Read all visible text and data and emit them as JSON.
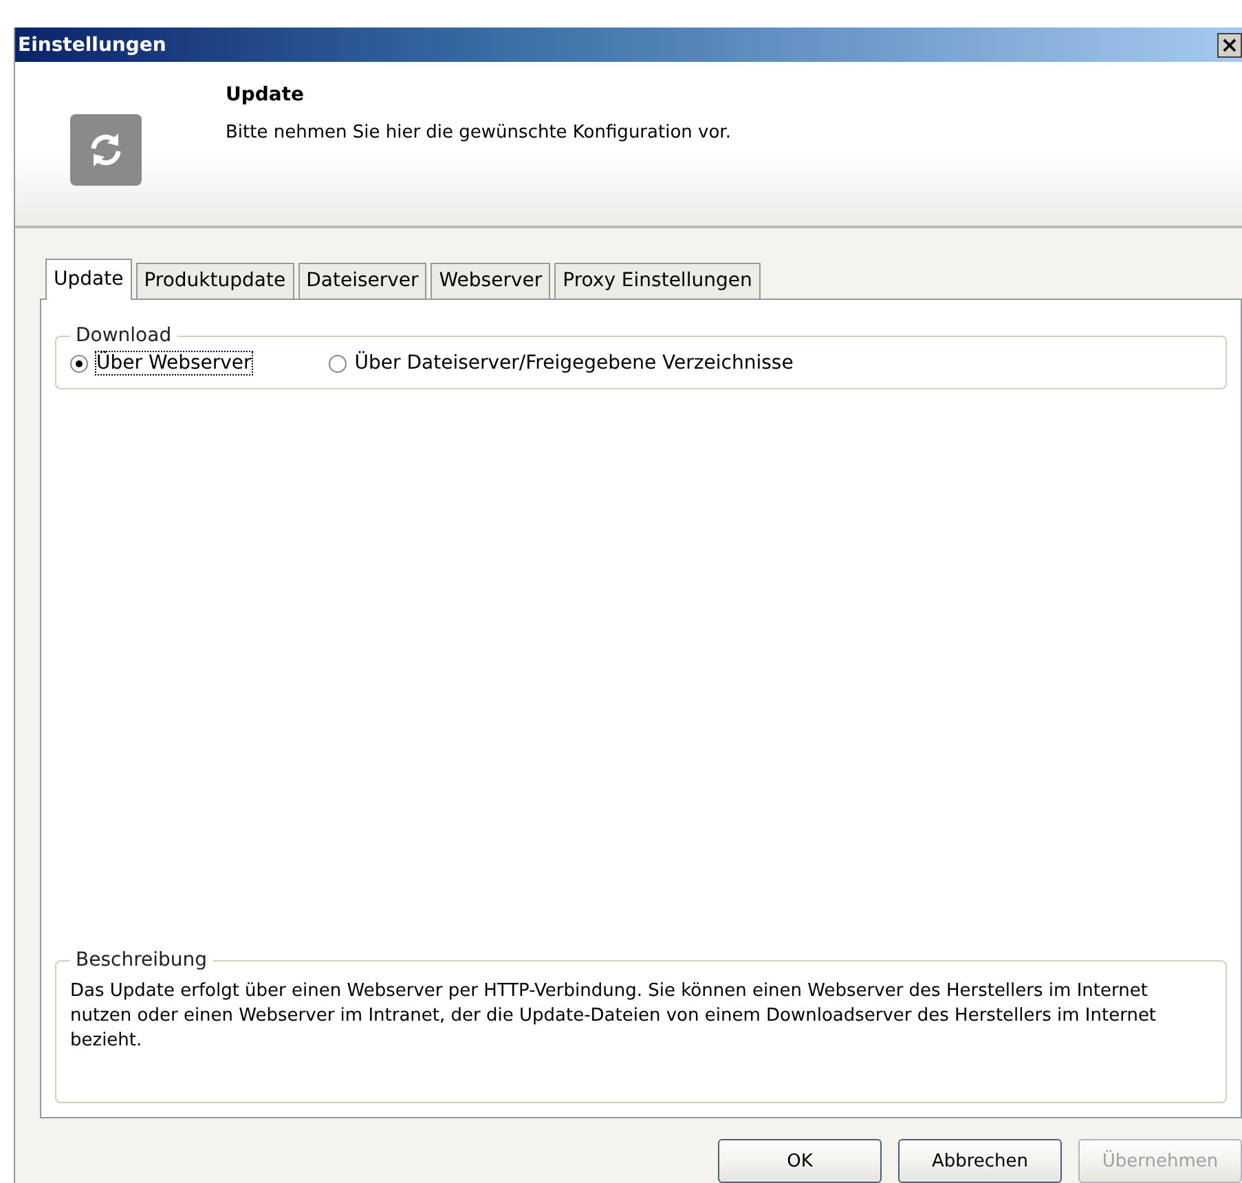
{
  "window": {
    "title": "Einstellungen",
    "close": "×"
  },
  "header": {
    "title": "Update",
    "subtitle": "Bitte nehmen Sie hier die gewünschte Konfiguration vor."
  },
  "tabs": [
    {
      "label": "Update",
      "selected": true
    },
    {
      "label": "Produktupdate",
      "selected": false
    },
    {
      "label": "Dateiserver",
      "selected": false
    },
    {
      "label": "Webserver",
      "selected": false
    },
    {
      "label": "Proxy Einstellungen",
      "selected": false
    }
  ],
  "download": {
    "legend": "Download",
    "options": [
      {
        "label": "Über Webserver",
        "selected": true
      },
      {
        "label": "Über Dateiserver/Freigegebene Verzeichnisse",
        "selected": false
      }
    ]
  },
  "description": {
    "legend": "Beschreibung",
    "text": "Das Update erfolgt über einen Webserver per HTTP-Verbindung. Sie können einen Webserver des Herstellers im Internet nutzen oder einen Webserver im Intranet, der die Update-Dateien von einem Downloadserver des Herstellers im Internet bezieht."
  },
  "buttons": [
    {
      "label": "OK",
      "disabled": false
    },
    {
      "label": "Abbrechen",
      "disabled": false
    },
    {
      "label": "Übernehmen",
      "disabled": true
    }
  ]
}
